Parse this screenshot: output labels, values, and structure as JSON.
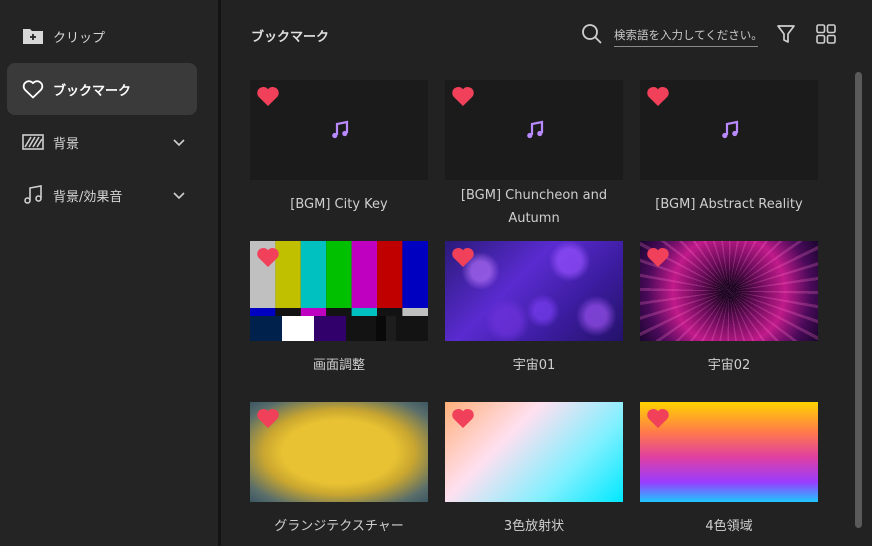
{
  "sidebar": {
    "items": [
      {
        "label": "クリップ",
        "icon": "folder-plus-icon"
      },
      {
        "label": "ブックマーク",
        "icon": "heart-outline-icon",
        "active": true
      },
      {
        "label": "背景",
        "icon": "striped-background-icon",
        "expandable": true
      },
      {
        "label": "背景/効果音",
        "icon": "music-note-icon",
        "expandable": true
      }
    ]
  },
  "main": {
    "title": "ブックマーク",
    "search": {
      "placeholder": "検索語を入力してください。",
      "value": ""
    },
    "toolbar": {
      "filter_icon": "filter-icon",
      "grid_icon": "grid-view-icon"
    }
  },
  "cards": [
    {
      "caption": "[BGM] City Key",
      "type": "audio",
      "bookmarked": true
    },
    {
      "caption": "[BGM] Chuncheon and Autumn",
      "type": "audio",
      "bookmarked": true
    },
    {
      "caption": "[BGM] Abstract Reality",
      "type": "audio",
      "bookmarked": true
    },
    {
      "caption": "画面調整",
      "type": "image",
      "bookmarked": true
    },
    {
      "caption": "宇宙01",
      "type": "image",
      "bookmarked": true
    },
    {
      "caption": "宇宙02",
      "type": "image",
      "bookmarked": true
    },
    {
      "caption": "グランジテクスチャー",
      "type": "image",
      "bookmarked": true
    },
    {
      "caption": "3色放射状",
      "type": "image",
      "bookmarked": true
    },
    {
      "caption": "4色領域",
      "type": "image",
      "bookmarked": true
    }
  ],
  "colors": {
    "accent_heart": "#f0405a",
    "music_note": "#b98aff",
    "background": "#222222",
    "sidebar_active": "#3a3a3a"
  }
}
